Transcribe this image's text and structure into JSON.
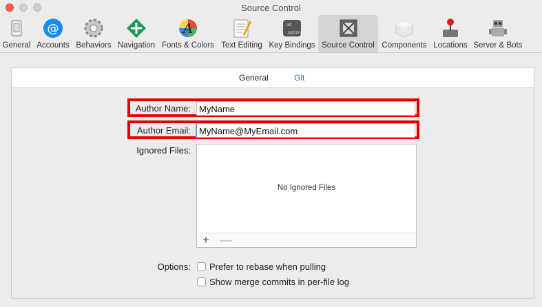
{
  "window": {
    "title": "Source Control"
  },
  "toolbar": {
    "items": [
      {
        "label": "General",
        "icon": "general-switch-icon"
      },
      {
        "label": "Accounts",
        "icon": "accounts-at-icon"
      },
      {
        "label": "Behaviors",
        "icon": "behaviors-gear-icon"
      },
      {
        "label": "Navigation",
        "icon": "navigation-arrows-icon"
      },
      {
        "label": "Fonts & Colors",
        "icon": "fonts-colors-icon"
      },
      {
        "label": "Text Editing",
        "icon": "text-editing-icon"
      },
      {
        "label": "Key Bindings",
        "icon": "key-bindings-icon"
      },
      {
        "label": "Source Control",
        "icon": "source-control-icon",
        "selected": true
      },
      {
        "label": "Components",
        "icon": "components-icon"
      },
      {
        "label": "Locations",
        "icon": "locations-joystick-icon"
      },
      {
        "label": "Server & Bots",
        "icon": "server-bots-icon"
      }
    ]
  },
  "tabs": {
    "general": "General",
    "git": "Git",
    "selected": "Git"
  },
  "form": {
    "author_name_label": "Author Name:",
    "author_name_value": "MyName",
    "author_email_label": "Author Email:",
    "author_email_value": "MyName@MyEmail.com",
    "ignored_files_label": "Ignored Files:",
    "ignored_files_empty": "No Ignored Files",
    "add_symbol": "+",
    "remove_symbol": "—",
    "options_label": "Options:",
    "option_rebase": "Prefer to rebase when pulling",
    "option_merge_commits": "Show merge commits in per-file log"
  },
  "colors": {
    "highlight": "#e00000",
    "accent": "#1e6fd8",
    "close": "#ff5f57"
  }
}
